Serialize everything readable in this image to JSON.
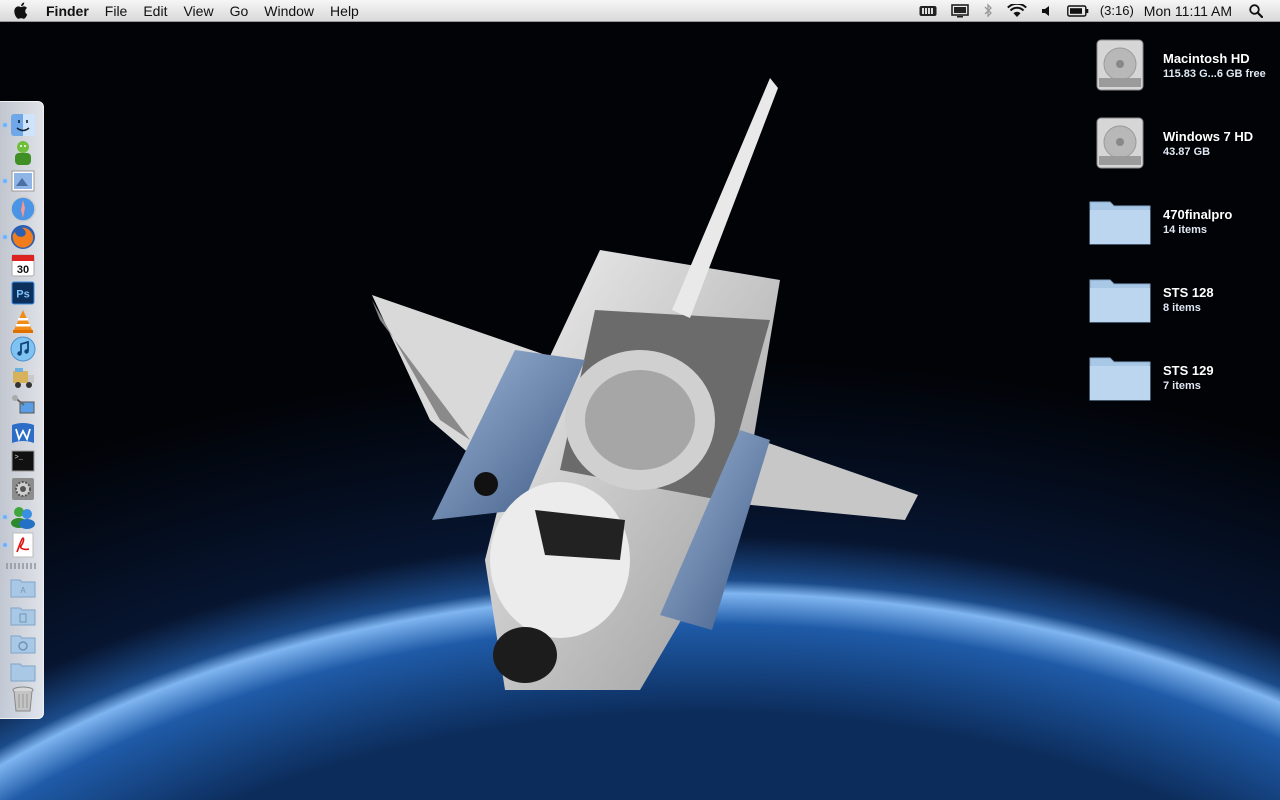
{
  "menubar": {
    "app_name": "Finder",
    "menus": [
      "File",
      "Edit",
      "View",
      "Go",
      "Window",
      "Help"
    ],
    "battery_time": "(3:16)",
    "clock": "Mon 11:11 AM"
  },
  "dock": {
    "items": [
      {
        "name": "finder",
        "running": true
      },
      {
        "name": "user-figure",
        "running": false
      },
      {
        "name": "preview",
        "running": true
      },
      {
        "name": "safari",
        "running": false
      },
      {
        "name": "firefox",
        "running": true
      },
      {
        "name": "ical",
        "running": false,
        "label": "30"
      },
      {
        "name": "photoshop",
        "running": false,
        "label": "Ps"
      },
      {
        "name": "vlc",
        "running": false
      },
      {
        "name": "itunes",
        "running": false
      },
      {
        "name": "transmit",
        "running": false
      },
      {
        "name": "network-utility",
        "running": false
      },
      {
        "name": "word",
        "running": false
      },
      {
        "name": "terminal",
        "running": false,
        "label": ">_"
      },
      {
        "name": "system-preferences",
        "running": false
      },
      {
        "name": "messenger",
        "running": true
      },
      {
        "name": "acrobat",
        "running": true
      }
    ],
    "stack_items": [
      "applications-folder",
      "documents-folder",
      "downloads-folder",
      "folder"
    ],
    "trash": "trash"
  },
  "desktop": {
    "items": [
      {
        "type": "drive",
        "name": "Macintosh HD",
        "info": "115.83 G...6 GB free"
      },
      {
        "type": "drive",
        "name": "Windows 7 HD",
        "info": "43.87 GB"
      },
      {
        "type": "folder",
        "name": "470finalpro",
        "info": "14 items"
      },
      {
        "type": "folder",
        "name": "STS 128",
        "info": "8 items"
      },
      {
        "type": "folder",
        "name": "STS 129",
        "info": "7 items"
      }
    ]
  },
  "colors": {
    "space": "#02040a",
    "earth_glow": "#3b82d6",
    "folder_blue": "#a9c8e6",
    "menubar": "#e8e8e8"
  }
}
